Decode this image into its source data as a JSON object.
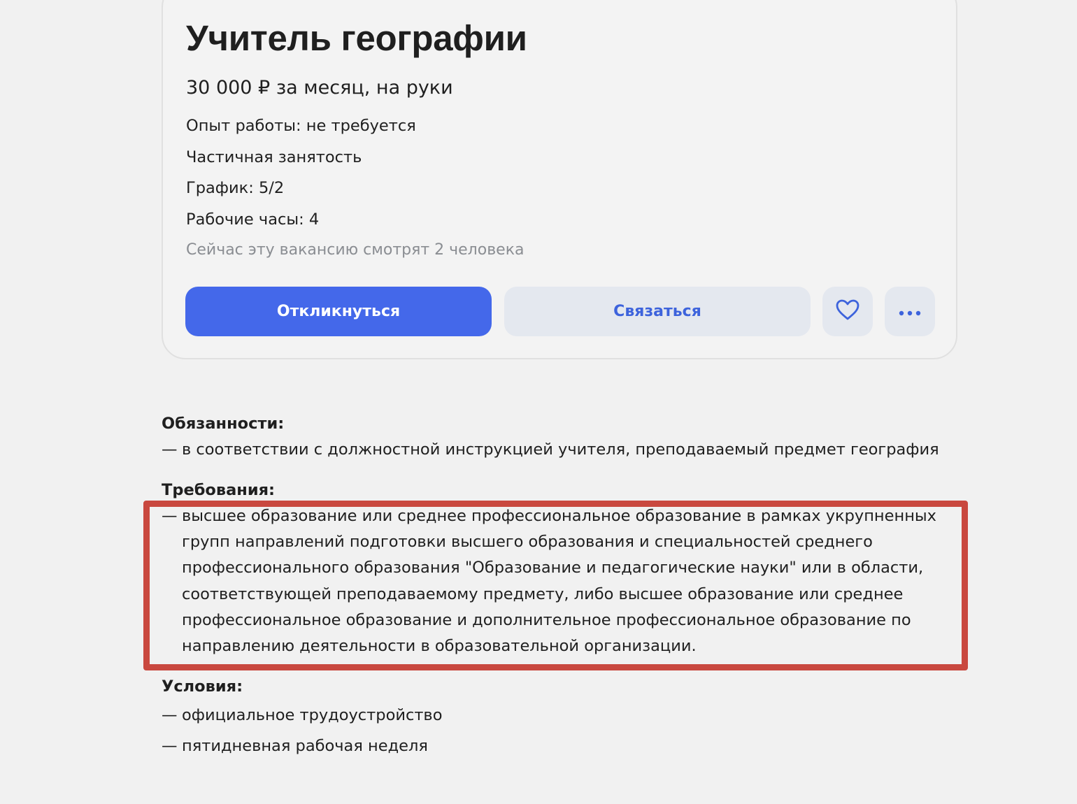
{
  "vacancy": {
    "title": "Учитель географии",
    "salary": "30 000 ₽ за месяц, на руки",
    "experience": "Опыт работы: не требуется",
    "employment": "Частичная занятость",
    "schedule": "График: 5/2",
    "hours": "Рабочие часы: 4",
    "viewers": "Сейчас эту вакансию смотрят 2 человека"
  },
  "actions": {
    "respond_label": "Откликнуться",
    "contact_label": "Связаться",
    "favorite_icon": "heart-icon",
    "more_icon": "more-dots-icon"
  },
  "description": {
    "duties_heading": "Обязанности:",
    "duties": [
      "в соответствии с должностной инструкцией учителя, преподаваемый предмет география"
    ],
    "requirements_heading": "Требования:",
    "requirements": [
      "высшее образование или среднее профессиональное образование в рамках укрупненных групп направлений подготовки высшего образования и специальностей среднего профессионального образования \"Образование и педагогические науки\" или в области, соответствующей преподаваемому предмету, либо высшее образование или среднее профессиональное образование и дополнительное профессиональное образование по направлению деятельности в образовательной организации."
    ],
    "conditions_heading": "Условия:",
    "conditions": [
      "официальное трудоустройство",
      "пятидневная рабочая неделя"
    ],
    "dash": "—"
  },
  "colors": {
    "background": "#f1f1f1",
    "primary_button": "#4468ea",
    "secondary_button": "#e4e8ef",
    "secondary_text": "#3d63dc",
    "muted_text": "#8a8d92",
    "highlight_border": "#c9483f"
  }
}
